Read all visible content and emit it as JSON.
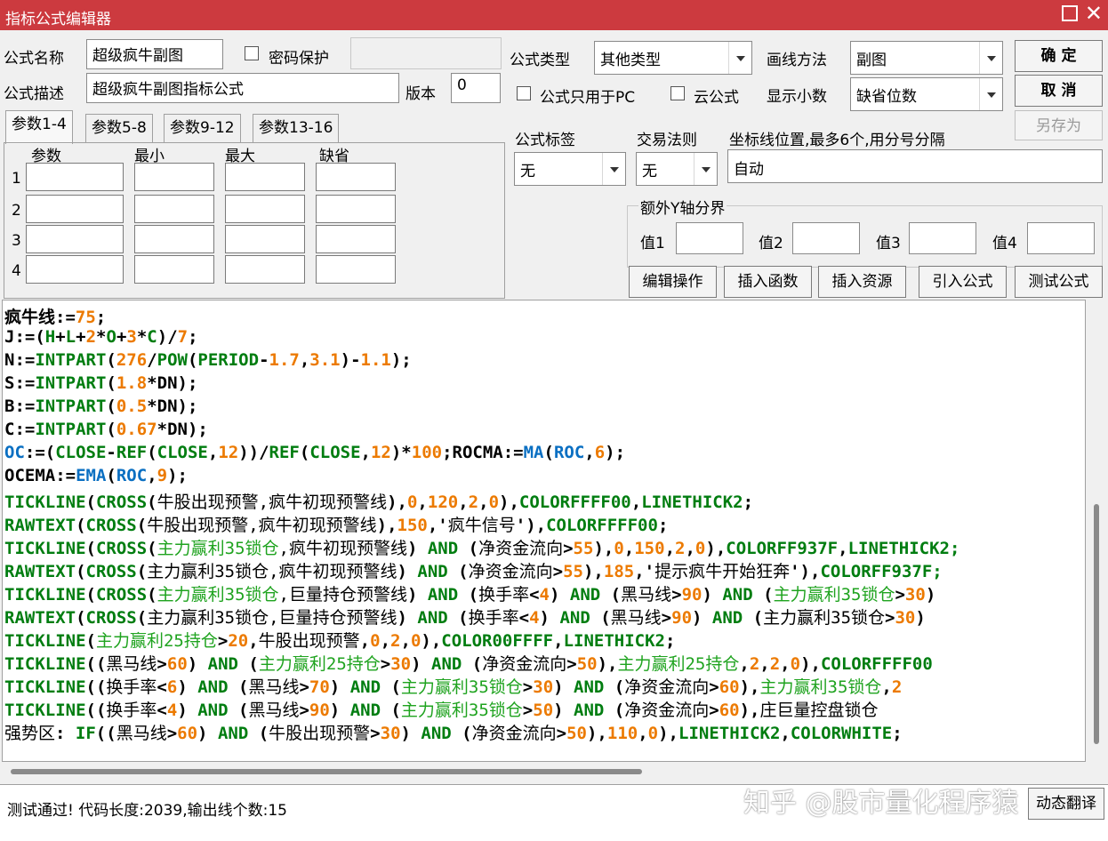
{
  "window": {
    "title": "指标公式编辑器",
    "close_glyph": "✕",
    "maximize_glyph": "☐"
  },
  "form": {
    "name_label": "公式名称",
    "name_value": "超级疯牛副图",
    "password_label": "密码保护",
    "desc_label": "公式描述",
    "desc_value": "超级疯牛副图指标公式",
    "version_label": "版本",
    "version_value": "0",
    "type_label": "公式类型",
    "type_value": "其他类型",
    "draw_label": "画线方法",
    "draw_value": "副图",
    "pc_only_label": "公式只用于PC",
    "cloud_label": "云公式",
    "decimal_label": "显示小数",
    "decimal_value": "缺省位数",
    "tag_label": "公式标签",
    "tag_value": "无",
    "trade_label": "交易法则",
    "trade_value": "无",
    "axis_label": "坐标线位置,最多6个,用分号分隔",
    "axis_value": "自动",
    "extra_y_label": "额外Y轴分界",
    "y1": "值1",
    "y2": "值2",
    "y3": "值3",
    "y4": "值4"
  },
  "buttons": {
    "ok": "确 定",
    "cancel": "取 消",
    "save_as": "另存为",
    "edit_op": "编辑操作",
    "insert_func": "插入函数",
    "insert_res": "插入资源",
    "import": "引入公式",
    "test": "测试公式",
    "translate": "动态翻译"
  },
  "tabs": [
    "参数1-4",
    "参数5-8",
    "参数9-12",
    "参数13-16"
  ],
  "params": {
    "headers": [
      "参数",
      "最小",
      "最大",
      "缺省"
    ],
    "rows": [
      "1",
      "2",
      "3",
      "4"
    ]
  },
  "code": [
    [
      [
        "n",
        "疯牛线:="
      ],
      [
        "o",
        "75"
      ],
      [
        "n",
        ";"
      ]
    ],
    [
      [
        "n",
        "J:=("
      ],
      [
        "k",
        "H"
      ],
      [
        "n",
        "+"
      ],
      [
        "k",
        "L"
      ],
      [
        "n",
        "+"
      ],
      [
        "o",
        "2"
      ],
      [
        "n",
        "*"
      ],
      [
        "k",
        "O"
      ],
      [
        "n",
        "+"
      ],
      [
        "o",
        "3"
      ],
      [
        "n",
        "*"
      ],
      [
        "k",
        "C"
      ],
      [
        "n",
        ")/"
      ],
      [
        "o",
        "7"
      ],
      [
        "n",
        ";"
      ]
    ],
    [
      [
        "n",
        "N:="
      ],
      [
        "k",
        "INTPART"
      ],
      [
        "n",
        "("
      ],
      [
        "o",
        "276"
      ],
      [
        "n",
        "/"
      ],
      [
        "k",
        "POW"
      ],
      [
        "n",
        "("
      ],
      [
        "k",
        "PERIOD"
      ],
      [
        "n",
        "-"
      ],
      [
        "o",
        "1.7"
      ],
      [
        "n",
        ","
      ],
      [
        "o",
        "3.1"
      ],
      [
        "n",
        ")-"
      ],
      [
        "o",
        "1.1"
      ],
      [
        "n",
        ");"
      ]
    ],
    [
      [
        "n",
        "S:="
      ],
      [
        "k",
        "INTPART"
      ],
      [
        "n",
        "("
      ],
      [
        "o",
        "1.8"
      ],
      [
        "n",
        "*DN);"
      ]
    ],
    [
      [
        "n",
        "B:="
      ],
      [
        "k",
        "INTPART"
      ],
      [
        "n",
        "("
      ],
      [
        "o",
        "0.5"
      ],
      [
        "n",
        "*DN);"
      ]
    ],
    [
      [
        "n",
        "C:="
      ],
      [
        "k",
        "INTPART"
      ],
      [
        "n",
        "("
      ],
      [
        "o",
        "0.67"
      ],
      [
        "n",
        "*DN);"
      ]
    ],
    [
      [
        "b",
        "OC"
      ],
      [
        "n",
        ":=("
      ],
      [
        "k",
        "CLOSE"
      ],
      [
        "n",
        "-"
      ],
      [
        "k",
        "REF"
      ],
      [
        "n",
        "("
      ],
      [
        "k",
        "CLOSE"
      ],
      [
        "n",
        ","
      ],
      [
        "o",
        "12"
      ],
      [
        "n",
        "))/"
      ],
      [
        "k",
        "REF"
      ],
      [
        "n",
        "("
      ],
      [
        "k",
        "CLOSE"
      ],
      [
        "n",
        ","
      ],
      [
        "o",
        "12"
      ],
      [
        "n",
        ")*"
      ],
      [
        "o",
        "100"
      ],
      [
        "n",
        ";ROCMA:="
      ],
      [
        "b",
        "MA"
      ],
      [
        "n",
        "("
      ],
      [
        "b",
        "ROC"
      ],
      [
        "n",
        ","
      ],
      [
        "o",
        "6"
      ],
      [
        "n",
        ");"
      ]
    ],
    [
      [
        "n",
        "OCEMA:="
      ],
      [
        "b",
        "EMA"
      ],
      [
        "n",
        "("
      ],
      [
        "b",
        "ROC"
      ],
      [
        "n",
        ","
      ],
      [
        "o",
        "9"
      ],
      [
        "n",
        ");"
      ]
    ],
    [
      [
        "k",
        "TICKLINE"
      ],
      [
        "n",
        "("
      ],
      [
        "k",
        "CROSS"
      ],
      [
        "n",
        "("
      ],
      [
        "z",
        "牛股出现预警,疯牛初现预警线"
      ],
      [
        "n",
        "),"
      ],
      [
        "o",
        "0"
      ],
      [
        "n",
        ","
      ],
      [
        "o",
        "120"
      ],
      [
        "n",
        ","
      ],
      [
        "o",
        "2"
      ],
      [
        "n",
        ","
      ],
      [
        "o",
        "0"
      ],
      [
        "n",
        "),"
      ],
      [
        "k",
        "COLORFFFF00"
      ],
      [
        "n",
        ","
      ],
      [
        "k",
        "LINETHICK2"
      ],
      [
        "n",
        ";"
      ]
    ],
    [
      [
        "k",
        "RAWTEXT"
      ],
      [
        "n",
        "("
      ],
      [
        "k",
        "CROSS"
      ],
      [
        "n",
        "("
      ],
      [
        "z",
        "牛股出现预警,疯牛初现预警线"
      ],
      [
        "n",
        "),"
      ],
      [
        "o",
        "150"
      ],
      [
        "n",
        ",'"
      ],
      [
        "z",
        "疯牛信号"
      ],
      [
        "n",
        "'),"
      ],
      [
        "k",
        "COLORFFFF00"
      ],
      [
        "n",
        ";"
      ]
    ],
    [
      [
        "k",
        "TICKLINE"
      ],
      [
        "n",
        "("
      ],
      [
        "k",
        "CROSS"
      ],
      [
        "n",
        "("
      ],
      [
        "g",
        "主力赢利35锁仓"
      ],
      [
        "z",
        ",疯牛初现预警线"
      ],
      [
        "n",
        ") "
      ],
      [
        "k",
        "AND"
      ],
      [
        "n",
        " ("
      ],
      [
        "z",
        "净资金流向"
      ],
      [
        "n",
        ">"
      ],
      [
        "o",
        "55"
      ],
      [
        "n",
        "),"
      ],
      [
        "o",
        "0"
      ],
      [
        "n",
        ","
      ],
      [
        "o",
        "150"
      ],
      [
        "n",
        ","
      ],
      [
        "o",
        "2"
      ],
      [
        "n",
        ","
      ],
      [
        "o",
        "0"
      ],
      [
        "n",
        "),"
      ],
      [
        "k",
        "COLORFF937F"
      ],
      [
        "n",
        ","
      ],
      [
        "k",
        "LINETHICK2;"
      ]
    ],
    [
      [
        "k",
        "RAWTEXT"
      ],
      [
        "n",
        "("
      ],
      [
        "k",
        "CROSS"
      ],
      [
        "n",
        "("
      ],
      [
        "z",
        "主力赢利35锁仓,疯牛初现预警线"
      ],
      [
        "n",
        ") "
      ],
      [
        "k",
        "AND"
      ],
      [
        "n",
        " ("
      ],
      [
        "z",
        "净资金流向"
      ],
      [
        "n",
        ">"
      ],
      [
        "o",
        "55"
      ],
      [
        "n",
        "),"
      ],
      [
        "o",
        "185"
      ],
      [
        "n",
        ",'"
      ],
      [
        "z",
        "提示疯牛开始狂奔"
      ],
      [
        "n",
        "'),"
      ],
      [
        "k",
        "COLORFF937F;"
      ]
    ],
    [
      [
        "k",
        "TICKLINE"
      ],
      [
        "n",
        "("
      ],
      [
        "k",
        "CROSS"
      ],
      [
        "n",
        "("
      ],
      [
        "g",
        "主力赢利35锁仓"
      ],
      [
        "z",
        ",巨量持仓预警线"
      ],
      [
        "n",
        ") "
      ],
      [
        "k",
        "AND"
      ],
      [
        "n",
        " ("
      ],
      [
        "z",
        "换手率"
      ],
      [
        "n",
        "<"
      ],
      [
        "o",
        "4"
      ],
      [
        "n",
        ") "
      ],
      [
        "k",
        "AND"
      ],
      [
        "n",
        " ("
      ],
      [
        "z",
        "黑马线"
      ],
      [
        "n",
        ">"
      ],
      [
        "o",
        "90"
      ],
      [
        "n",
        ") "
      ],
      [
        "k",
        "AND"
      ],
      [
        "n",
        " ("
      ],
      [
        "g",
        "主力赢利35锁仓"
      ],
      [
        "n",
        ">"
      ],
      [
        "o",
        "30"
      ],
      [
        "n",
        ")"
      ]
    ],
    [
      [
        "k",
        "RAWTEXT"
      ],
      [
        "n",
        "("
      ],
      [
        "k",
        "CROSS"
      ],
      [
        "n",
        "("
      ],
      [
        "z",
        "主力赢利35锁仓,巨量持仓预警线"
      ],
      [
        "n",
        ") "
      ],
      [
        "k",
        "AND"
      ],
      [
        "n",
        " ("
      ],
      [
        "z",
        "换手率"
      ],
      [
        "n",
        "<"
      ],
      [
        "o",
        "4"
      ],
      [
        "n",
        ") "
      ],
      [
        "k",
        "AND"
      ],
      [
        "n",
        " ("
      ],
      [
        "z",
        "黑马线"
      ],
      [
        "n",
        ">"
      ],
      [
        "o",
        "90"
      ],
      [
        "n",
        ") "
      ],
      [
        "k",
        "AND"
      ],
      [
        "n",
        " ("
      ],
      [
        "z",
        "主力赢利35锁仓"
      ],
      [
        "n",
        ">"
      ],
      [
        "o",
        "30"
      ],
      [
        "n",
        ")"
      ]
    ],
    [
      [
        "k",
        "TICKLINE"
      ],
      [
        "n",
        "("
      ],
      [
        "g",
        "主力赢利25持仓"
      ],
      [
        "n",
        ">"
      ],
      [
        "o",
        "20"
      ],
      [
        "n",
        ","
      ],
      [
        "z",
        "牛股出现预警"
      ],
      [
        "n",
        ","
      ],
      [
        "o",
        "0"
      ],
      [
        "n",
        ","
      ],
      [
        "o",
        "2"
      ],
      [
        "n",
        ","
      ],
      [
        "o",
        "0"
      ],
      [
        "n",
        "),"
      ],
      [
        "k",
        "COLOR00FFFF"
      ],
      [
        "n",
        ","
      ],
      [
        "k",
        "LINETHICK2"
      ],
      [
        "n",
        ";"
      ]
    ],
    [
      [
        "k",
        "TICKLINE"
      ],
      [
        "n",
        "(("
      ],
      [
        "z",
        "黑马线"
      ],
      [
        "n",
        ">"
      ],
      [
        "o",
        "60"
      ],
      [
        "n",
        ") "
      ],
      [
        "k",
        "AND"
      ],
      [
        "n",
        " ("
      ],
      [
        "g",
        "主力赢利25持仓"
      ],
      [
        "n",
        ">"
      ],
      [
        "o",
        "30"
      ],
      [
        "n",
        ") "
      ],
      [
        "k",
        "AND"
      ],
      [
        "n",
        " ("
      ],
      [
        "z",
        "净资金流向"
      ],
      [
        "n",
        ">"
      ],
      [
        "o",
        "50"
      ],
      [
        "n",
        "),"
      ],
      [
        "g",
        "主力赢利25持仓"
      ],
      [
        "n",
        ","
      ],
      [
        "o",
        "2"
      ],
      [
        "n",
        ","
      ],
      [
        "o",
        "2"
      ],
      [
        "n",
        ","
      ],
      [
        "o",
        "0"
      ],
      [
        "n",
        "),"
      ],
      [
        "k",
        "COLORFFFF00"
      ]
    ],
    [
      [
        "k",
        "TICKLINE"
      ],
      [
        "n",
        "(("
      ],
      [
        "z",
        "换手率"
      ],
      [
        "n",
        "<"
      ],
      [
        "o",
        "6"
      ],
      [
        "n",
        ") "
      ],
      [
        "k",
        "AND"
      ],
      [
        "n",
        " ("
      ],
      [
        "z",
        "黑马线"
      ],
      [
        "n",
        ">"
      ],
      [
        "o",
        "70"
      ],
      [
        "n",
        ") "
      ],
      [
        "k",
        "AND"
      ],
      [
        "n",
        " ("
      ],
      [
        "g",
        "主力赢利35锁仓"
      ],
      [
        "n",
        ">"
      ],
      [
        "o",
        "30"
      ],
      [
        "n",
        ") "
      ],
      [
        "k",
        "AND"
      ],
      [
        "n",
        " ("
      ],
      [
        "z",
        "净资金流向"
      ],
      [
        "n",
        ">"
      ],
      [
        "o",
        "60"
      ],
      [
        "n",
        "),"
      ],
      [
        "g",
        "主力赢利35锁仓"
      ],
      [
        "n",
        ","
      ],
      [
        "o",
        "2"
      ]
    ],
    [
      [
        "k",
        "TICKLINE"
      ],
      [
        "n",
        "(("
      ],
      [
        "z",
        "换手率"
      ],
      [
        "n",
        "<"
      ],
      [
        "o",
        "4"
      ],
      [
        "n",
        ") "
      ],
      [
        "k",
        "AND"
      ],
      [
        "n",
        " ("
      ],
      [
        "z",
        "黑马线"
      ],
      [
        "n",
        ">"
      ],
      [
        "o",
        "90"
      ],
      [
        "n",
        ") "
      ],
      [
        "k",
        "AND"
      ],
      [
        "n",
        " ("
      ],
      [
        "g",
        "主力赢利35锁仓"
      ],
      [
        "n",
        ">"
      ],
      [
        "o",
        "50"
      ],
      [
        "n",
        ") "
      ],
      [
        "k",
        "AND"
      ],
      [
        "n",
        " ("
      ],
      [
        "z",
        "净资金流向"
      ],
      [
        "n",
        ">"
      ],
      [
        "o",
        "60"
      ],
      [
        "n",
        "),"
      ],
      [
        "z",
        "庄巨量控盘锁仓"
      ]
    ],
    [
      [
        "z",
        "强势区"
      ],
      [
        "n",
        ": "
      ],
      [
        "k",
        "IF"
      ],
      [
        "n",
        "(("
      ],
      [
        "z",
        "黑马线"
      ],
      [
        "n",
        ">"
      ],
      [
        "o",
        "60"
      ],
      [
        "n",
        ") "
      ],
      [
        "k",
        "AND"
      ],
      [
        "n",
        " ("
      ],
      [
        "z",
        "牛股出现预警"
      ],
      [
        "n",
        ">"
      ],
      [
        "o",
        "30"
      ],
      [
        "n",
        ") "
      ],
      [
        "k",
        "AND"
      ],
      [
        "n",
        " ("
      ],
      [
        "z",
        "净资金流向"
      ],
      [
        "n",
        ">"
      ],
      [
        "o",
        "50"
      ],
      [
        "n",
        "),"
      ],
      [
        "o",
        "110"
      ],
      [
        "n",
        ","
      ],
      [
        "o",
        "0"
      ],
      [
        "n",
        "),"
      ],
      [
        "k",
        "LINETHICK2"
      ],
      [
        "n",
        ","
      ],
      [
        "k",
        "COLORWHITE"
      ],
      [
        "n",
        ";"
      ]
    ]
  ],
  "status": "测试通过! 代码长度:2039,输出线个数:15",
  "watermark": "知乎 @股市量化程序猿"
}
